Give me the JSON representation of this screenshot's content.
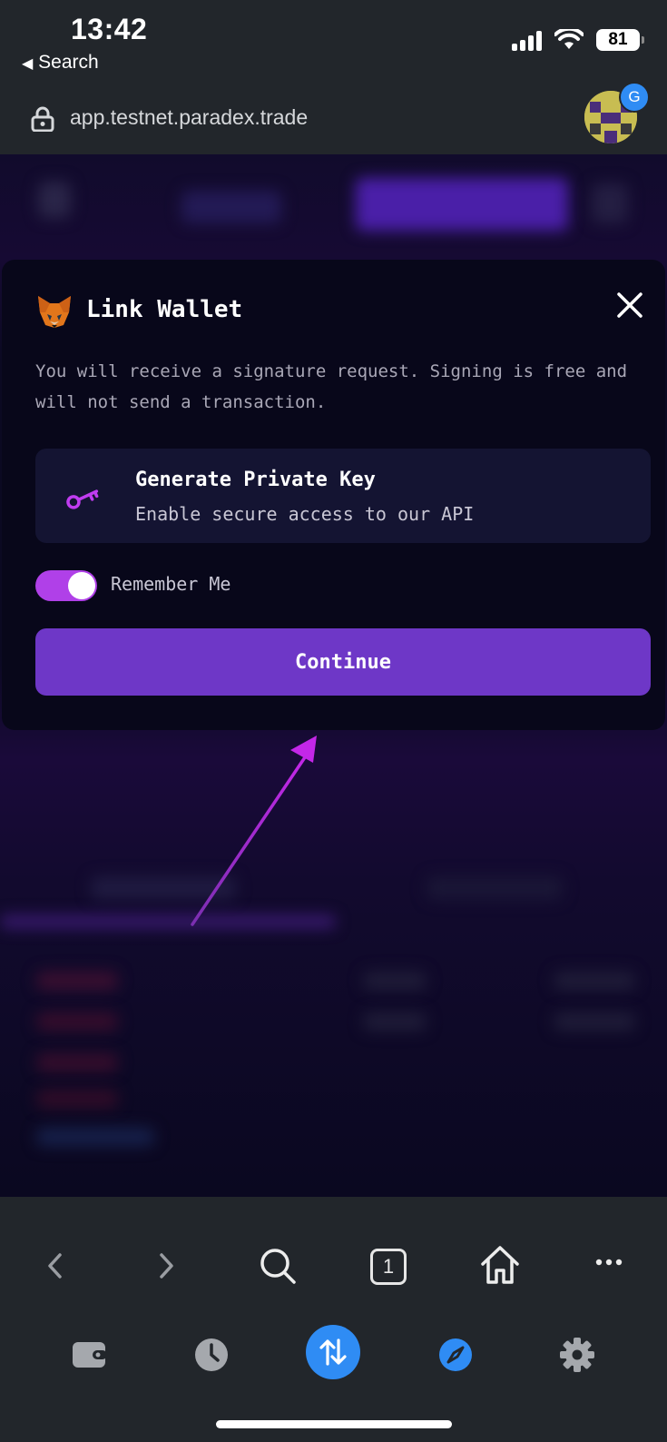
{
  "status_bar": {
    "time": "13:42",
    "back_label": "Search",
    "battery_level": "81"
  },
  "browser": {
    "url": "app.testnet.paradex.trade",
    "account_badge": "G"
  },
  "modal": {
    "title": "Link Wallet",
    "description": "You will receive a signature request. Signing is free and will not send a transaction.",
    "option": {
      "title": "Generate Private Key",
      "subtitle": "Enable secure access to our API"
    },
    "remember_label": "Remember Me",
    "remember_enabled": true,
    "continue_label": "Continue"
  },
  "toolbar": {
    "tab_count": "1",
    "icons": [
      "back-icon",
      "forward-icon",
      "search-icon",
      "tabs-icon",
      "home-icon",
      "more-icon",
      "wallet-icon",
      "history-icon",
      "swap-icon",
      "explore-icon",
      "settings-icon"
    ]
  },
  "colors": {
    "accent_purple": "#6e37c7",
    "toggle_on": "#b040e8",
    "action_blue": "#2f8cf4",
    "chrome_bg": "#22262b",
    "modal_bg": "#08071a"
  }
}
